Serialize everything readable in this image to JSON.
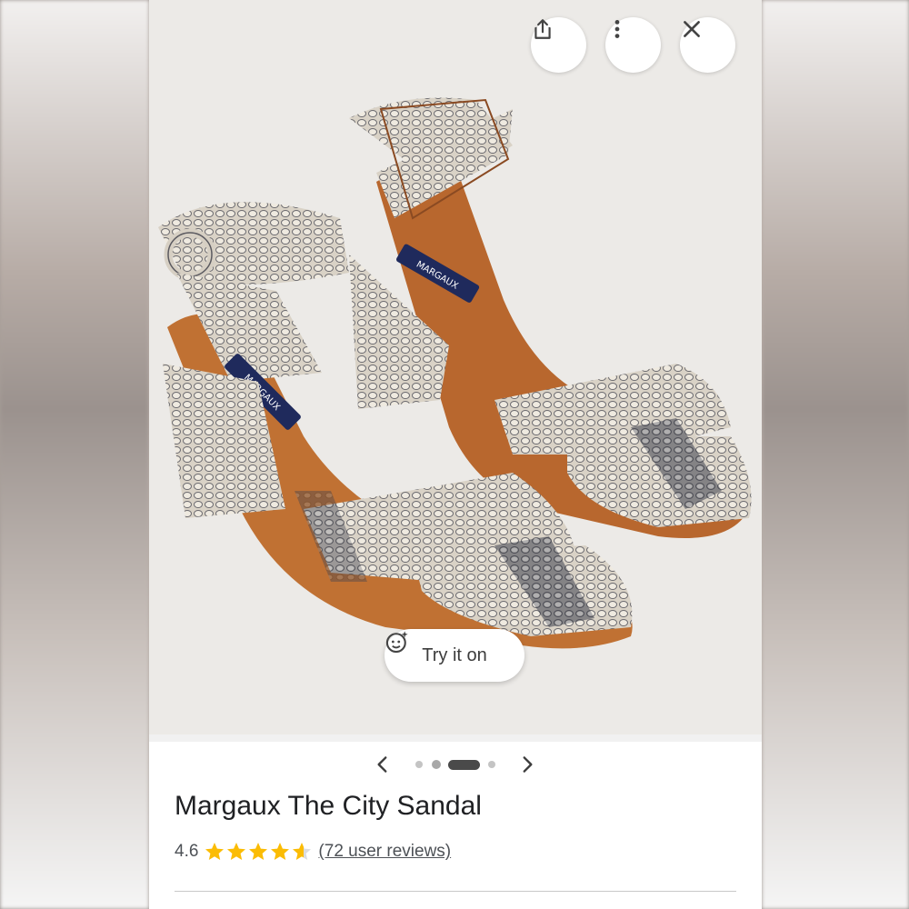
{
  "toolbar": {
    "share_icon": "share-icon",
    "more_icon": "more-vert-icon",
    "close_icon": "close-icon"
  },
  "image": {
    "brand_label": "MARGAUX",
    "try_on_label": "Try it on",
    "try_on_icon": "face-sparkle-icon"
  },
  "pager": {
    "prev_icon": "chevron-left-icon",
    "next_icon": "chevron-right-icon",
    "dot_count": 4,
    "active_index": 2
  },
  "product": {
    "title": "Margaux The City Sandal",
    "rating": "4.6",
    "rating_value": 4.6,
    "stars_max": 5,
    "reviews": "(72 user reviews)"
  },
  "colors": {
    "star": "#fbbc04",
    "text_primary": "#202124",
    "text_secondary": "#4d5156"
  }
}
